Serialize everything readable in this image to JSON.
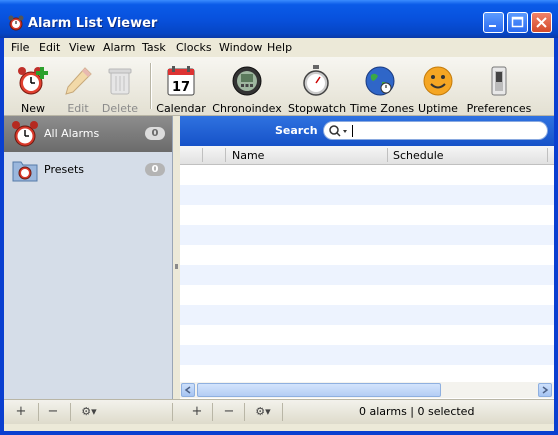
{
  "window": {
    "title": "Alarm List Viewer"
  },
  "menu": [
    "File",
    "Edit",
    "View",
    "Alarm",
    "Task",
    "Clocks",
    "Window",
    "Help"
  ],
  "toolbar": {
    "new": "New",
    "edit": "Edit",
    "delete": "Delete",
    "calendar": "Calendar",
    "calendar_day": "17",
    "chronoindex": "Chronoindex",
    "stopwatch": "Stopwatch",
    "time_zones": "Time Zones",
    "uptime": "Uptime",
    "preferences": "Preferences"
  },
  "sidebar": {
    "items": [
      {
        "label": "All Alarms",
        "count": "0",
        "selected": true
      },
      {
        "label": "Presets",
        "count": "0",
        "selected": false
      }
    ]
  },
  "search": {
    "label": "Search",
    "value": ""
  },
  "table": {
    "columns": [
      "Name",
      "Schedule"
    ],
    "rows": []
  },
  "bottom": {
    "add": "+",
    "remove": "−",
    "gear": "⚙▾",
    "status": "0 alarms | 0 selected"
  },
  "colors": {
    "accent": "#1652c8",
    "titlebar": "#0851dd"
  }
}
